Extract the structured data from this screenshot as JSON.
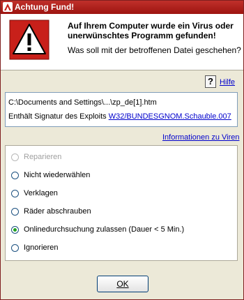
{
  "window": {
    "title": "Achtung Fund!"
  },
  "header": {
    "heading": "Auf Ihrem Computer wurde ein Virus oder unerwünschtes Programm gefunden!",
    "question": "Was soll mit der betroffenen Datei geschehen?"
  },
  "help": {
    "icon_glyph": "?",
    "label": "Hilfe"
  },
  "detection": {
    "file_path": "C:\\Documents and Settings\\...\\zp_de[1].htm",
    "signature_prefix": "Enthält Signatur des Exploits ",
    "signature_link": "W32/BUNDESGNOM.Schauble.007"
  },
  "info_link": "Informationen zu Viren",
  "options": [
    {
      "label": "Reparieren",
      "checked": false,
      "disabled": true
    },
    {
      "label": "Nicht wiederwählen",
      "checked": false,
      "disabled": false
    },
    {
      "label": "Verklagen",
      "checked": false,
      "disabled": false
    },
    {
      "label": "Räder abschrauben",
      "checked": false,
      "disabled": false
    },
    {
      "label": "Onlinedurchsuchung zulassen (Dauer < 5 Min.)",
      "checked": true,
      "disabled": false
    },
    {
      "label": "Ignorieren",
      "checked": false,
      "disabled": false
    }
  ],
  "ok_button": "OK",
  "colors": {
    "titlebar": "#b11e1a",
    "link": "#0000cc",
    "warning_red": "#c8201a",
    "selected_radio": "#21a121"
  }
}
